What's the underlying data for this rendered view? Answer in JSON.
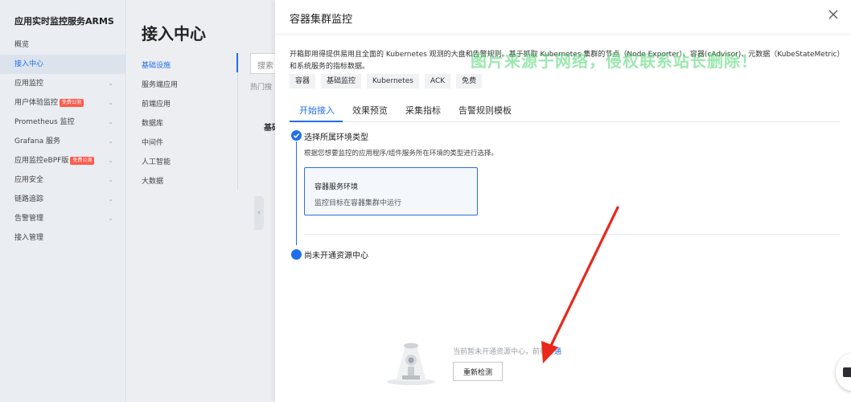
{
  "sidebar": {
    "title": "应用实时监控服务ARMS",
    "items": [
      {
        "label": "概览",
        "has_chevron": false
      },
      {
        "label": "接入中心",
        "has_chevron": false,
        "active": true
      },
      {
        "label": "应用监控",
        "has_chevron": true
      },
      {
        "label": "用户体验监控",
        "has_chevron": true,
        "badge": "免费公测"
      },
      {
        "label": "Prometheus 监控",
        "has_chevron": true
      },
      {
        "label": "Grafana 服务",
        "has_chevron": true
      },
      {
        "label": "应用监控eBPF版",
        "has_chevron": true,
        "badge": "免费公测"
      },
      {
        "label": "应用安全",
        "has_chevron": true
      },
      {
        "label": "链路追踪",
        "has_chevron": true
      },
      {
        "label": "告警管理",
        "has_chevron": true
      },
      {
        "label": "接入管理",
        "has_chevron": false
      }
    ]
  },
  "center": {
    "title": "接入中心",
    "categories": [
      "基础设施",
      "服务端应用",
      "前端应用",
      "数据库",
      "中间件",
      "人工智能",
      "大数据"
    ],
    "active_category": "基础设施",
    "search_placeholder": "搜索",
    "hot_search_label": "热门搜",
    "section_heading_fragment": "基础"
  },
  "drawer": {
    "title": "容器集群监控",
    "description": "开箱即用得提供易用且全面的 Kubernetes 观测的大盘和告警规则。基于抓取 Kubernetes 集群的节点（Node Exporter）、容器(cAdvisor)、元数据（KubeStateMetric）和系统服务的指标数据。",
    "watermark": "图片来源于网络，侵权联系站长删除！",
    "tags": [
      "容器",
      "基础监控",
      "Kubernetes",
      "ACK",
      "免费"
    ],
    "tabs": [
      "开始接入",
      "效果预览",
      "采集指标",
      "告警规则模板"
    ],
    "active_tab": "开始接入",
    "step1": {
      "title": "选择所属环境类型",
      "hint": "根据您想要监控的应用程序/组件服务所在环境的类型进行选择。",
      "card": {
        "title": "容器服务环境",
        "desc": "监控目标在容器集群中运行"
      }
    },
    "step2": {
      "title": "尚未开通资源中心"
    },
    "empty": {
      "text": "当前暂未开通资源中心，前往",
      "link": "开通",
      "retry_label": "重新检测"
    }
  },
  "colors": {
    "accent": "#1f6feb",
    "watermark": "#4ad66e",
    "arrow": "#e8291c",
    "badge": "#ff5a4d"
  },
  "icons": {
    "close": "close-icon",
    "check": "check-icon",
    "chevron": "chevron-down-icon",
    "help": "help-icon"
  }
}
